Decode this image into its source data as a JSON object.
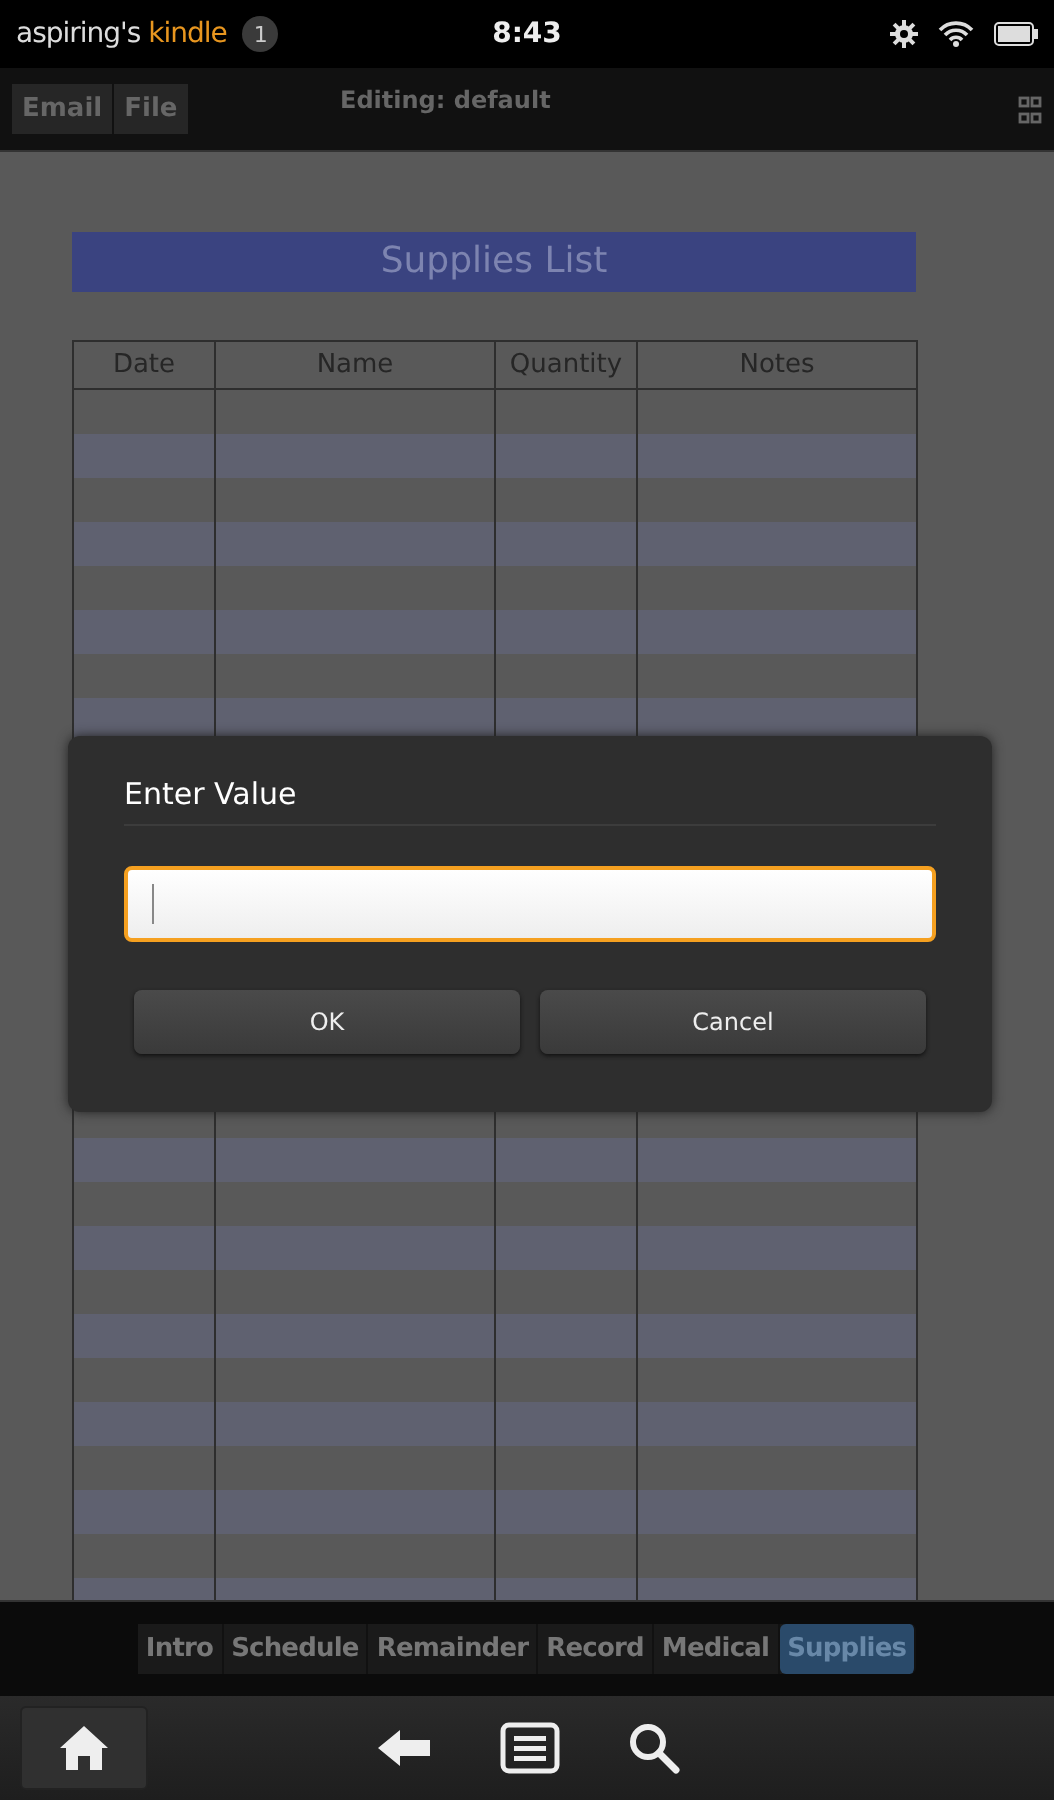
{
  "status_bar": {
    "device_owner": "aspiring's",
    "device_brand": "kindle",
    "notification_count": "1",
    "time": "8:43"
  },
  "toolbar": {
    "buttons": [
      "Email",
      "File"
    ],
    "title": "Editing: default"
  },
  "sheet": {
    "title": "Supplies List",
    "columns": [
      "Date",
      "Name",
      "Quantity",
      "Notes"
    ]
  },
  "dialog": {
    "title": "Enter Value",
    "input": {
      "focused": true
    },
    "buttons": [
      "OK",
      "Cancel"
    ]
  },
  "tabs": [
    {
      "label": "Intro",
      "selected": false
    },
    {
      "label": "Schedule",
      "selected": false
    },
    {
      "label": "Remainder",
      "selected": false
    },
    {
      "label": "Record",
      "selected": false
    },
    {
      "label": "Medical",
      "selected": false
    },
    {
      "label": "Supplies",
      "selected": true
    }
  ]
}
